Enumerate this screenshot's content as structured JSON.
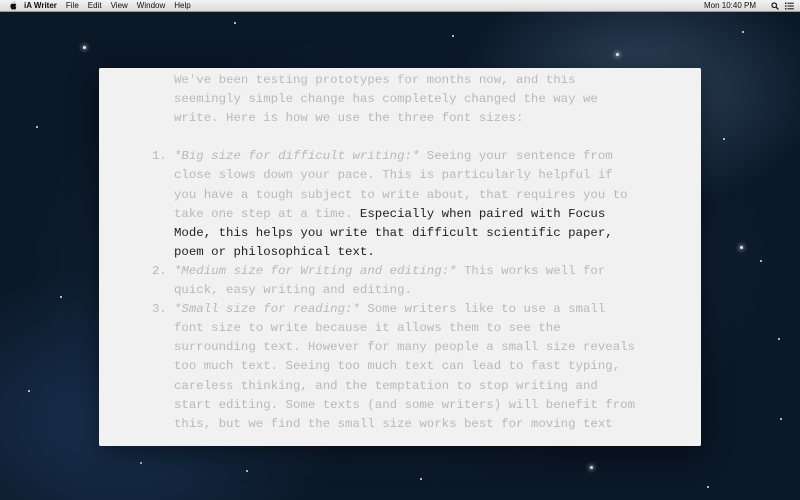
{
  "menubar": {
    "apple_icon": "apple-icon",
    "app_name": "iA Writer",
    "menus": [
      "File",
      "Edit",
      "View",
      "Window",
      "Help"
    ],
    "clock": "Mon 10:40 PM",
    "status_icons": [
      "spotlight-icon",
      "list-icon"
    ]
  },
  "document": {
    "lines": [
      {
        "num": "",
        "parts": [
          {
            "t": "We've been testing prototypes for months now, and this"
          }
        ]
      },
      {
        "num": "",
        "parts": [
          {
            "t": "seemingly simple change has completely changed the way we"
          }
        ]
      },
      {
        "num": "",
        "parts": [
          {
            "t": "write. Here is how we use the three font sizes:"
          }
        ]
      },
      {
        "num": "",
        "parts": [
          {
            "t": ""
          }
        ]
      },
      {
        "num": "1.",
        "parts": [
          {
            "t": "*Big size for difficult writing:*",
            "i": true
          },
          {
            "t": " Seeing your sentence from"
          }
        ]
      },
      {
        "num": "",
        "parts": [
          {
            "t": "close slows down your pace. This is particularly helpful if"
          }
        ]
      },
      {
        "num": "",
        "parts": [
          {
            "t": "you have a tough subject to write about, that requires you to"
          }
        ]
      },
      {
        "num": "",
        "parts": [
          {
            "t": "take one step at a time. "
          },
          {
            "t": "Especially when paired with Focus",
            "f": true
          }
        ]
      },
      {
        "num": "",
        "parts": [
          {
            "t": "Mode, this helps you write that difficult scientific paper,",
            "f": true
          }
        ]
      },
      {
        "num": "",
        "parts": [
          {
            "t": "poem or philosophical text.",
            "f": true
          }
        ]
      },
      {
        "num": "2.",
        "parts": [
          {
            "t": "*Medium size for Writing and editing:*",
            "i": true
          },
          {
            "t": " This works well for"
          }
        ]
      },
      {
        "num": "",
        "parts": [
          {
            "t": "quick, easy writing and editing."
          }
        ]
      },
      {
        "num": "3.",
        "parts": [
          {
            "t": "*Small size for reading:*",
            "i": true
          },
          {
            "t": " Some writers like to use a small"
          }
        ]
      },
      {
        "num": "",
        "parts": [
          {
            "t": "font size to write because it allows them to see the"
          }
        ]
      },
      {
        "num": "",
        "parts": [
          {
            "t": "surrounding text. However for many people a small size reveals"
          }
        ]
      },
      {
        "num": "",
        "parts": [
          {
            "t": "too much text. Seeing too much text can lead to fast typing,"
          }
        ]
      },
      {
        "num": "",
        "parts": [
          {
            "t": "careless thinking, and the temptation to stop writing and"
          }
        ]
      },
      {
        "num": "",
        "parts": [
          {
            "t": "start editing. Some texts (and some writers) will benefit from"
          }
        ]
      },
      {
        "num": "",
        "parts": [
          {
            "t": "this, but we find the small size works best for moving text"
          }
        ]
      }
    ]
  },
  "colors": {
    "dimmed_text": "#b9b9b9",
    "focused_text": "#222222",
    "paper": "#f1f1f1"
  }
}
